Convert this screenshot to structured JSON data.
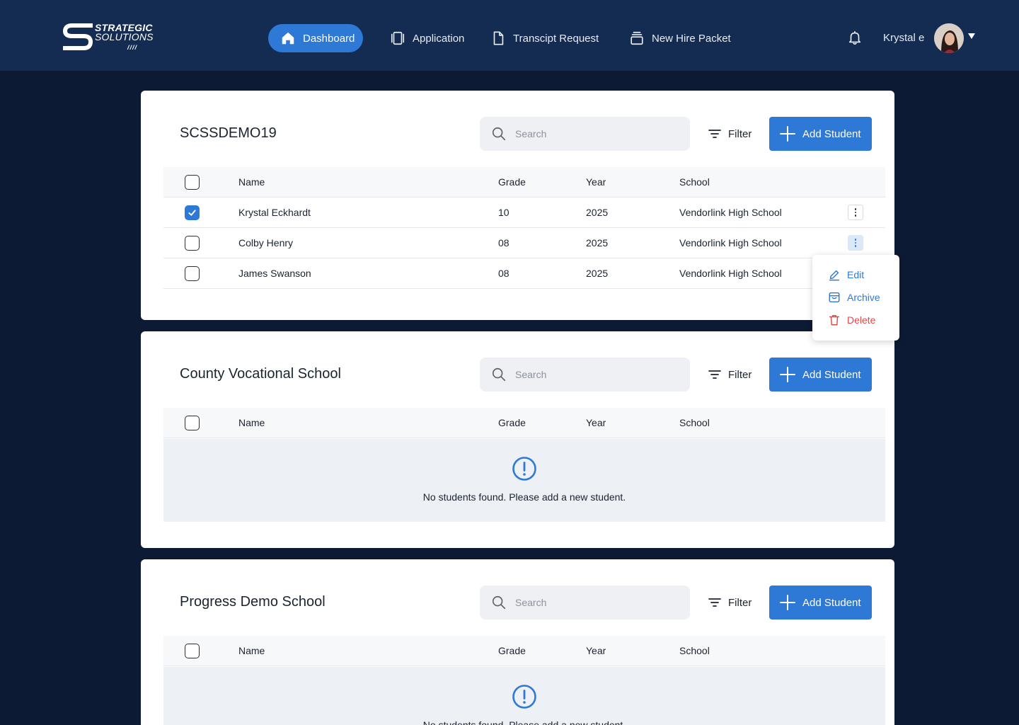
{
  "brand": {
    "line1": "STRATEGIC",
    "line2": "SOLUTIONS",
    "accent": "#2e79d6"
  },
  "nav": {
    "dashboard": "Dashboard",
    "application": "Application",
    "transcript": "Transcipt Request",
    "newhire": "New Hire Packet"
  },
  "user": {
    "name": "Krystal e"
  },
  "cards": [
    {
      "title": "SCSSDEMO19",
      "search_placeholder": "Search",
      "filter_label": "Filter",
      "add_label": "Add Student",
      "columns": [
        "Name",
        "Grade",
        "Year",
        "School"
      ],
      "rows": [
        {
          "name": "Krystal Eckhardt",
          "grade": "10",
          "year": "2025",
          "school": "Vendorlink High School",
          "checked": true
        },
        {
          "name": "Colby Henry",
          "grade": "08",
          "year": "2025",
          "school": "Vendorlink High School",
          "checked": false
        },
        {
          "name": "James Swanson",
          "grade": "08",
          "year": "2025",
          "school": "Vendorlink High School",
          "checked": false
        }
      ]
    },
    {
      "title": "County Vocational School",
      "search_placeholder": "Search",
      "filter_label": "Filter",
      "add_label": "Add Student",
      "columns": [
        "Name",
        "Grade",
        "Year",
        "School"
      ],
      "empty_message": "No students found. Please add a new student."
    },
    {
      "title": "Progress Demo School",
      "search_placeholder": "Search",
      "filter_label": "Filter",
      "add_label": "Add Student",
      "columns": [
        "Name",
        "Grade",
        "Year",
        "School"
      ],
      "empty_message": "No students found. Please add a new student."
    }
  ],
  "row_menu": {
    "edit": "Edit",
    "archive": "Archive",
    "delete": "Delete"
  }
}
